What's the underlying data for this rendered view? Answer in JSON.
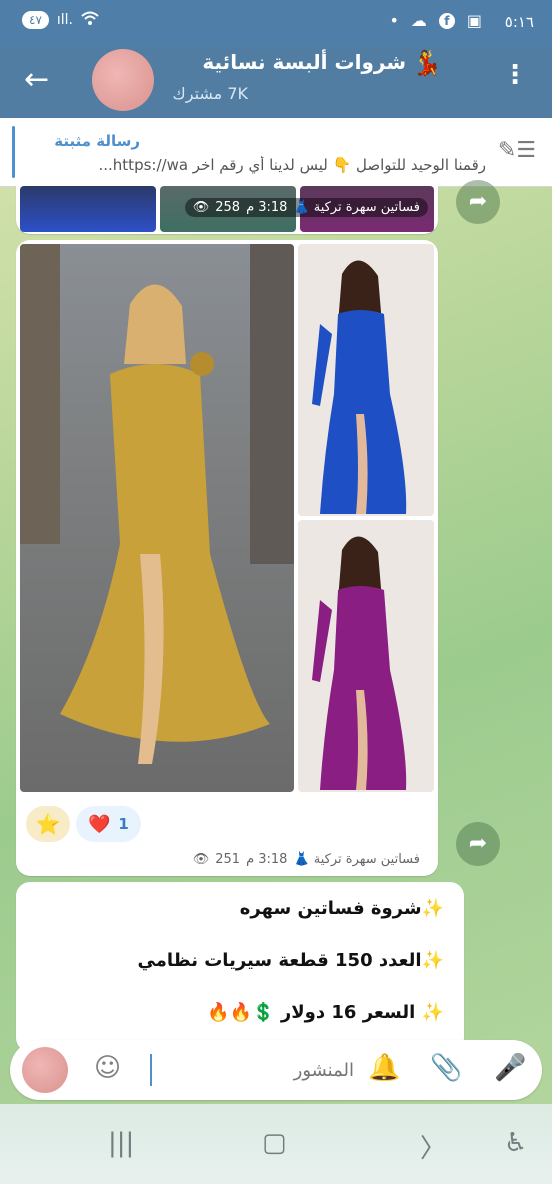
{
  "status_bar": {
    "time": "٥:١٦",
    "battery": "٤٧",
    "signal_icons": "ıll.",
    "icons": [
      "dot-icon",
      "cloud-icon",
      "facebook-icon",
      "screen-capture-icon",
      "wifi-icon"
    ]
  },
  "channel": {
    "title": "شروات ألبسة نسائية",
    "title_emoji": "💃",
    "subscribers": "7K مشترك"
  },
  "pinned": {
    "label": "رسالة مثبتة",
    "text": "رقمنا الوحيد للتواصل 👇 ليس لدينا أي رقم اخر https://wa..."
  },
  "messages": [
    {
      "views": "258",
      "time": "3:18 م",
      "author": "فساتين سهرة تركية 👗"
    },
    {
      "views": "251",
      "time": "3:18 م",
      "author": "فساتين سهرة تركية 👗",
      "reaction_count": "1",
      "reaction_heart": "❤️",
      "reaction_star": "⭐"
    },
    {
      "lines": [
        "✨شروة فساتين سهره",
        "✨العدد 150 قطعة سيريات نظامي",
        "✨ السعر 16 دولار 💲🔥🔥"
      ]
    }
  ],
  "composer": {
    "placeholder": "المنشور"
  },
  "colors": {
    "header": "#517da2",
    "gold_dress": "#c9a13b",
    "blue_dress": "#1f4fc4",
    "purple_dress": "#8b1e82",
    "link": "#4f8fce"
  }
}
